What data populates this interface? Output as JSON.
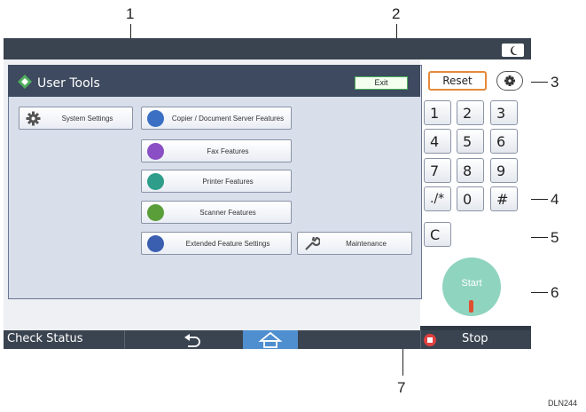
{
  "callouts": [
    "1",
    "2",
    "3",
    "4",
    "5",
    "6",
    "7"
  ],
  "header": {
    "title": "User Tools",
    "exit_label": "Exit"
  },
  "tiles": {
    "system_settings": "System Settings",
    "copier": "Copier / Document Server Features",
    "fax": "Fax Features",
    "printer": "Printer Features",
    "scanner": "Scanner Features",
    "extended": "Extended Feature Settings",
    "maintenance": "Maintenance"
  },
  "keypad": {
    "reset_label": "Reset",
    "keys": [
      "1",
      "2",
      "3",
      "4",
      "5",
      "6",
      "7",
      "8",
      "9",
      "./*",
      "0",
      "#"
    ],
    "clear_label": "C",
    "start_label": "Start"
  },
  "bottom_bar": {
    "check_status": "Check Status",
    "stop_label": "Stop"
  },
  "figure_id": "DLN244",
  "colors": {
    "accent_green": "#8fd4bf",
    "reset_border": "#e58a3a",
    "stop_icon": "#e04040"
  }
}
